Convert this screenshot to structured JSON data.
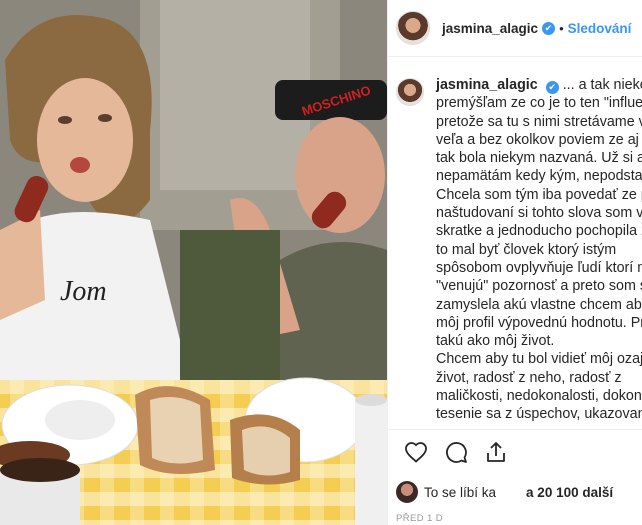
{
  "post": {
    "photo_shirt_text": "Jom",
    "photo_cap_text": "MOSCHINO"
  },
  "header": {
    "username": "jasmina_alagic",
    "verified_mark": "✔",
    "separator": "•",
    "follow_label": "Sledování"
  },
  "caption": {
    "username": "jasmina_alagic",
    "verified_mark": "✔",
    "lines": [
      "... a tak niekedy",
      "premýšľam ze co je to ten \"influencer\"",
      "pretože sa tu s nimi stretávame veľmi",
      "veľa a bez okolkov poviem ze aj ja som",
      "tak bola niekym nazvaná. Už si ale",
      "nepamätám kedy kým, nepodstatne.",
      "Chcela som tým iba povedať ze po",
      "naštudovaní si tohto slova som v",
      "skratke a jednoducho pochopila ze by",
      "to mal byť človek ktorý istým",
      "spôsobom ovplyvňuje ľudí ktorí mu",
      "\"venujú\" pozornosť a preto som sa",
      "zamyslela akú vlastne chcem aby mal",
      "môj profil výpovednú hodnotu. Presne",
      "takú ako môj život.",
      "Chcem aby tu bol vidieť môj ozajstný",
      "život, radosť z neho, radosť z",
      "maličkosti, nedokonalosti, dokonalosti,",
      "tesenie sa z úspechov, ukazovanie veci"
    ]
  },
  "actions": {
    "like_icon": "heart-icon",
    "comment_icon": "comment-icon",
    "share_icon": "share-icon"
  },
  "likes": {
    "prefix": "To se líbí ka",
    "suffix": "a 20 100 další"
  },
  "timestamp": "PŘED 1 D",
  "colors": {
    "accent": "#3897f0",
    "text": "#262626",
    "muted": "#999999",
    "divider": "#efefef"
  }
}
